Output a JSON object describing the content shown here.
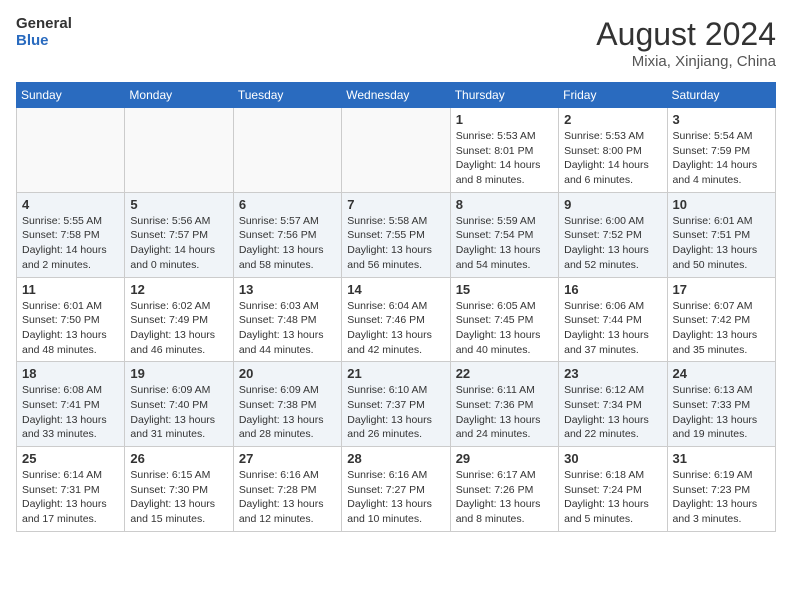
{
  "header": {
    "logo_line1": "General",
    "logo_line2": "Blue",
    "month_year": "August 2024",
    "location": "Mixia, Xinjiang, China"
  },
  "weekdays": [
    "Sunday",
    "Monday",
    "Tuesday",
    "Wednesday",
    "Thursday",
    "Friday",
    "Saturday"
  ],
  "weeks": [
    [
      {
        "day": "",
        "info": ""
      },
      {
        "day": "",
        "info": ""
      },
      {
        "day": "",
        "info": ""
      },
      {
        "day": "",
        "info": ""
      },
      {
        "day": "1",
        "info": "Sunrise: 5:53 AM\nSunset: 8:01 PM\nDaylight: 14 hours\nand 8 minutes."
      },
      {
        "day": "2",
        "info": "Sunrise: 5:53 AM\nSunset: 8:00 PM\nDaylight: 14 hours\nand 6 minutes."
      },
      {
        "day": "3",
        "info": "Sunrise: 5:54 AM\nSunset: 7:59 PM\nDaylight: 14 hours\nand 4 minutes."
      }
    ],
    [
      {
        "day": "4",
        "info": "Sunrise: 5:55 AM\nSunset: 7:58 PM\nDaylight: 14 hours\nand 2 minutes."
      },
      {
        "day": "5",
        "info": "Sunrise: 5:56 AM\nSunset: 7:57 PM\nDaylight: 14 hours\nand 0 minutes."
      },
      {
        "day": "6",
        "info": "Sunrise: 5:57 AM\nSunset: 7:56 PM\nDaylight: 13 hours\nand 58 minutes."
      },
      {
        "day": "7",
        "info": "Sunrise: 5:58 AM\nSunset: 7:55 PM\nDaylight: 13 hours\nand 56 minutes."
      },
      {
        "day": "8",
        "info": "Sunrise: 5:59 AM\nSunset: 7:54 PM\nDaylight: 13 hours\nand 54 minutes."
      },
      {
        "day": "9",
        "info": "Sunrise: 6:00 AM\nSunset: 7:52 PM\nDaylight: 13 hours\nand 52 minutes."
      },
      {
        "day": "10",
        "info": "Sunrise: 6:01 AM\nSunset: 7:51 PM\nDaylight: 13 hours\nand 50 minutes."
      }
    ],
    [
      {
        "day": "11",
        "info": "Sunrise: 6:01 AM\nSunset: 7:50 PM\nDaylight: 13 hours\nand 48 minutes."
      },
      {
        "day": "12",
        "info": "Sunrise: 6:02 AM\nSunset: 7:49 PM\nDaylight: 13 hours\nand 46 minutes."
      },
      {
        "day": "13",
        "info": "Sunrise: 6:03 AM\nSunset: 7:48 PM\nDaylight: 13 hours\nand 44 minutes."
      },
      {
        "day": "14",
        "info": "Sunrise: 6:04 AM\nSunset: 7:46 PM\nDaylight: 13 hours\nand 42 minutes."
      },
      {
        "day": "15",
        "info": "Sunrise: 6:05 AM\nSunset: 7:45 PM\nDaylight: 13 hours\nand 40 minutes."
      },
      {
        "day": "16",
        "info": "Sunrise: 6:06 AM\nSunset: 7:44 PM\nDaylight: 13 hours\nand 37 minutes."
      },
      {
        "day": "17",
        "info": "Sunrise: 6:07 AM\nSunset: 7:42 PM\nDaylight: 13 hours\nand 35 minutes."
      }
    ],
    [
      {
        "day": "18",
        "info": "Sunrise: 6:08 AM\nSunset: 7:41 PM\nDaylight: 13 hours\nand 33 minutes."
      },
      {
        "day": "19",
        "info": "Sunrise: 6:09 AM\nSunset: 7:40 PM\nDaylight: 13 hours\nand 31 minutes."
      },
      {
        "day": "20",
        "info": "Sunrise: 6:09 AM\nSunset: 7:38 PM\nDaylight: 13 hours\nand 28 minutes."
      },
      {
        "day": "21",
        "info": "Sunrise: 6:10 AM\nSunset: 7:37 PM\nDaylight: 13 hours\nand 26 minutes."
      },
      {
        "day": "22",
        "info": "Sunrise: 6:11 AM\nSunset: 7:36 PM\nDaylight: 13 hours\nand 24 minutes."
      },
      {
        "day": "23",
        "info": "Sunrise: 6:12 AM\nSunset: 7:34 PM\nDaylight: 13 hours\nand 22 minutes."
      },
      {
        "day": "24",
        "info": "Sunrise: 6:13 AM\nSunset: 7:33 PM\nDaylight: 13 hours\nand 19 minutes."
      }
    ],
    [
      {
        "day": "25",
        "info": "Sunrise: 6:14 AM\nSunset: 7:31 PM\nDaylight: 13 hours\nand 17 minutes."
      },
      {
        "day": "26",
        "info": "Sunrise: 6:15 AM\nSunset: 7:30 PM\nDaylight: 13 hours\nand 15 minutes."
      },
      {
        "day": "27",
        "info": "Sunrise: 6:16 AM\nSunset: 7:28 PM\nDaylight: 13 hours\nand 12 minutes."
      },
      {
        "day": "28",
        "info": "Sunrise: 6:16 AM\nSunset: 7:27 PM\nDaylight: 13 hours\nand 10 minutes."
      },
      {
        "day": "29",
        "info": "Sunrise: 6:17 AM\nSunset: 7:26 PM\nDaylight: 13 hours\nand 8 minutes."
      },
      {
        "day": "30",
        "info": "Sunrise: 6:18 AM\nSunset: 7:24 PM\nDaylight: 13 hours\nand 5 minutes."
      },
      {
        "day": "31",
        "info": "Sunrise: 6:19 AM\nSunset: 7:23 PM\nDaylight: 13 hours\nand 3 minutes."
      }
    ]
  ]
}
